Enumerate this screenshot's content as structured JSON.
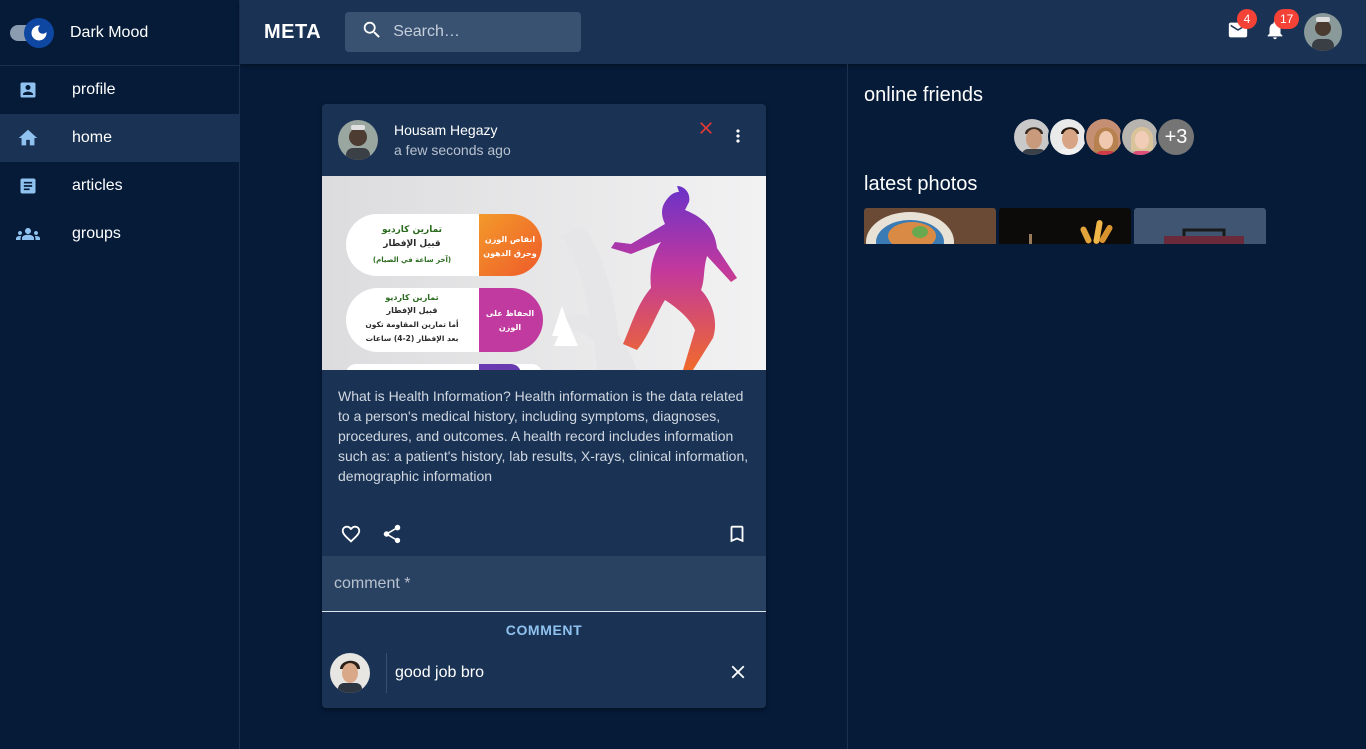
{
  "sidebar": {
    "theme_label": "Dark Mood",
    "items": [
      {
        "label": "profile",
        "icon": "account-box-icon"
      },
      {
        "label": "home",
        "icon": "home-icon",
        "active": true
      },
      {
        "label": "articles",
        "icon": "article-icon"
      },
      {
        "label": "groups",
        "icon": "groups-icon"
      }
    ]
  },
  "topbar": {
    "brand": "META",
    "search_placeholder": "Search…",
    "mail_count": "4",
    "notification_count": "17"
  },
  "post": {
    "author": "Housam Hegazy",
    "time": "a few seconds ago",
    "image_text": {
      "pill1_left": "تمارين كارديو",
      "pill1_left_2": "قبيل الإفطار",
      "pill1_left_3": "(آخر ساعة في الصيام)",
      "pill1_right": "انقاص الوزن",
      "pill1_right_2": "وحرق الدهون",
      "pill2_left": "تمارين كارديو",
      "pill2_left_2": "قبيل الإفطار",
      "pill2_left_3": "أما تمارين المقاومة تكون",
      "pill2_left_4": "بعد الإفطار (2-4) ساعات",
      "pill2_right": "الحفاظ على",
      "pill2_right_2": "الوزن"
    },
    "body": "What is Health Information? Health information is the data related to a person's medical history, including symptoms, diagnoses, procedures, and outcomes. A health record includes information such as: a patient's history, lab results, X-rays, clinical information, demographic information",
    "comment_placeholder": "comment *",
    "comment_button": "COMMENT",
    "comments": [
      {
        "text": "good job bro"
      }
    ]
  },
  "right_panel": {
    "online_title": "online friends",
    "more_count": "+3",
    "photos_title": "latest photos"
  },
  "colors": {
    "background": "#051b38",
    "surface": "#1a3354",
    "accent": "#90c2f0",
    "badge": "#f44336",
    "close_red": "#e53935"
  }
}
